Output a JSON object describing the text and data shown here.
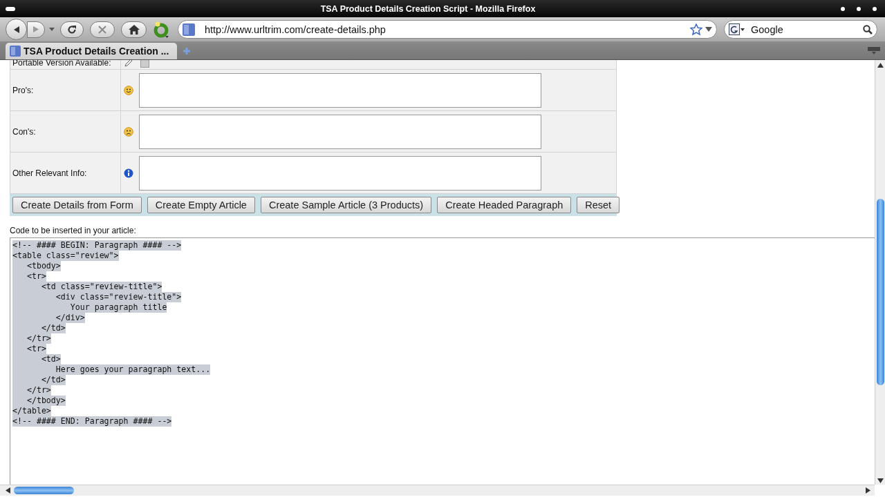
{
  "window": {
    "title": "TSA Product Details Creation Script - Mozilla Firefox"
  },
  "toolbar": {
    "url": "http://www.urltrim.com/create-details.php",
    "search": {
      "placeholder": "Google"
    }
  },
  "tabs": [
    {
      "label": "TSA Product Details Creation ...",
      "selected": true
    }
  ],
  "form": {
    "rows": [
      {
        "label": "Portable Version Available:",
        "kind": "checkbox",
        "checked": false
      },
      {
        "label": "Pro's:",
        "kind": "positive"
      },
      {
        "label": "Con's:",
        "kind": "negative"
      },
      {
        "label": "Other Relevant Info:",
        "kind": "info"
      }
    ],
    "buttons": [
      "Create Details from Form",
      "Create Empty Article",
      "Create Sample Article (3 Products)",
      "Create Headed Paragraph",
      "Reset"
    ]
  },
  "code": {
    "label": "Code to be inserted in your article:",
    "lines": [
      "<!-- #### BEGIN: Paragraph #### -->",
      "<table class=\"review\">",
      "   <tbody>",
      "   <tr>",
      "      <td class=\"review-title\">",
      "         <div class=\"review-title\">",
      "            Your paragraph title",
      "         </div>",
      "      </td>",
      "   </tr>",
      "   <tr>",
      "      <td>",
      "         Here goes your paragraph text...",
      "      </td>",
      "   </tr>",
      "   </tbody>",
      "</table>",
      "<!-- #### END: Paragraph #### -->"
    ]
  }
}
